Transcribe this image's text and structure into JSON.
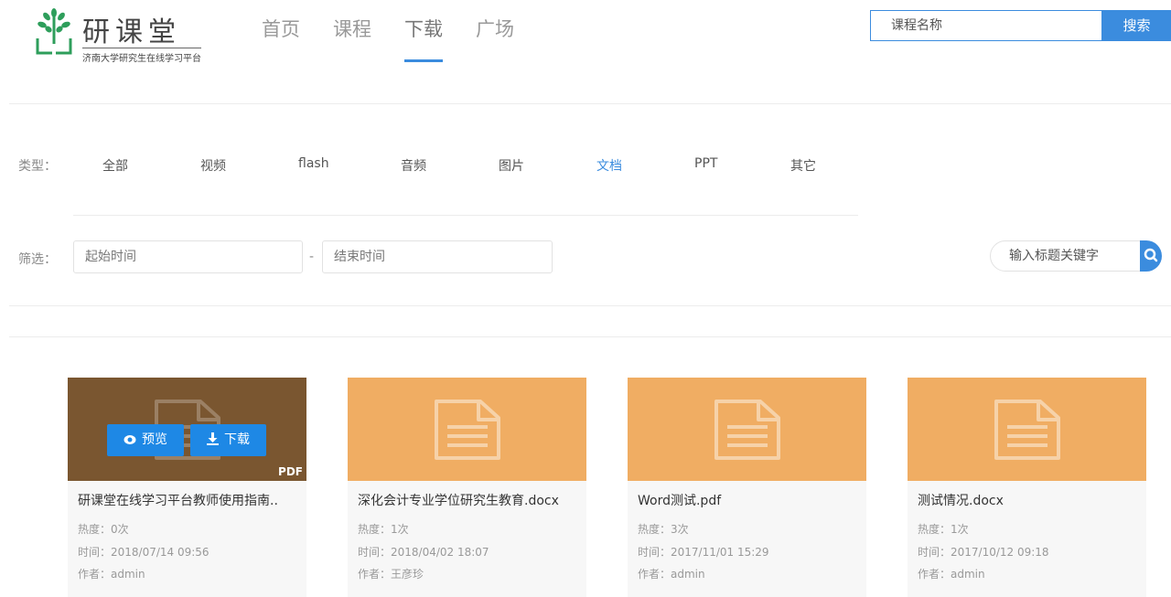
{
  "logo": {
    "title": "研课堂",
    "subtitle": "济南大学研究生在线学习平台",
    "icon": "tree-logo-icon"
  },
  "nav": [
    {
      "label": "首页",
      "active": false
    },
    {
      "label": "课程",
      "active": false
    },
    {
      "label": "下载",
      "active": true
    },
    {
      "label": "广场",
      "active": false
    }
  ],
  "search": {
    "placeholder": "课程名称",
    "button": "搜索"
  },
  "filters": {
    "type_label": "类型：",
    "types": [
      "全部",
      "视频",
      "flash",
      "音频",
      "图片",
      "文档",
      "PPT",
      "其它"
    ],
    "active_type": "文档",
    "filter_label": "筛选：",
    "start_placeholder": "起始时间",
    "dash": "-",
    "end_placeholder": "结束时间",
    "keyword_placeholder": "输入标题关键字"
  },
  "cards": [
    {
      "title": "研课堂在线学习平台教师使用指南..",
      "heat": "热度：0次",
      "time": "时间：2018/07/14 09:56",
      "author": "作者：admin",
      "preview": "预览",
      "download": "下载",
      "tag": "PDF",
      "hover": true
    },
    {
      "title": "深化会计专业学位研究生教育.docx",
      "heat": "热度：1次",
      "time": "时间：2018/04/02 18:07",
      "author": "作者：王彦珍"
    },
    {
      "title": "Word测试.pdf",
      "heat": "热度：3次",
      "time": "时间：2017/11/01 15:29",
      "author": "作者：admin"
    },
    {
      "title": "测试情况.docx",
      "heat": "热度：1次",
      "time": "时间：2017/10/12 09:18",
      "author": "作者：admin"
    }
  ],
  "colors": {
    "accent": "#3b8cde",
    "thumb": "#f0ad63",
    "thumb_hover": "#7a5630",
    "overlay_button": "#1e88e5"
  }
}
